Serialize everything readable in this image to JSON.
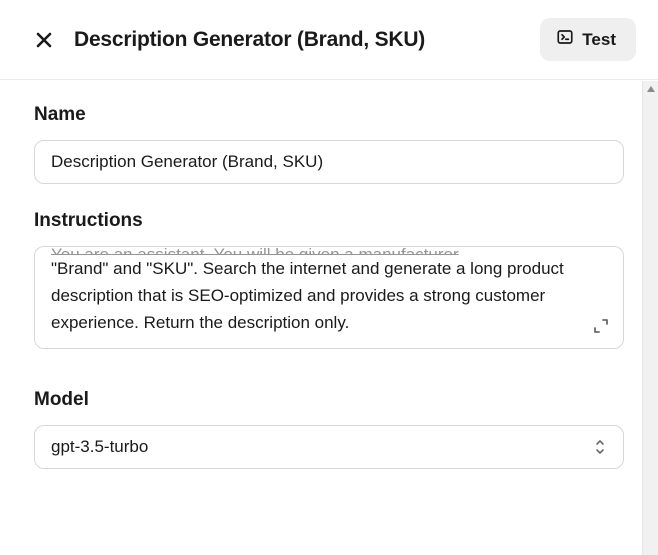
{
  "header": {
    "title": "Description Generator (Brand, SKU)",
    "test_label": "Test"
  },
  "fields": {
    "name": {
      "label": "Name",
      "value": "Description Generator (Brand, SKU)"
    },
    "instructions": {
      "label": "Instructions",
      "truncated_line": "You are an assistant.  You will be given a manufacturer",
      "value": "\"Brand\" and \"SKU\".  Search the internet and generate a long product description that is SEO-optimized and provides a strong customer experience.  Return the description only."
    },
    "model": {
      "label": "Model",
      "selected": "gpt-3.5-turbo"
    }
  }
}
